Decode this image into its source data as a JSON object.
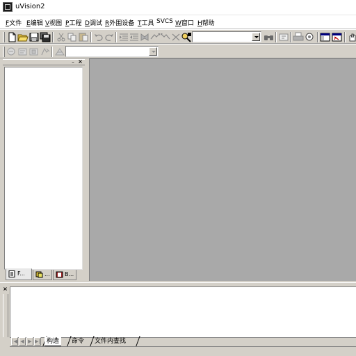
{
  "window": {
    "title": "uVision2"
  },
  "menu": {
    "items": [
      {
        "key": "F",
        "label": "文件"
      },
      {
        "key": "E",
        "label": "编辑"
      },
      {
        "key": "V",
        "label": "视图"
      },
      {
        "key": "P",
        "label": "工程"
      },
      {
        "key": "D",
        "label": "调试"
      },
      {
        "key": "R",
        "label": "外围设备"
      },
      {
        "key": "T",
        "label": "工具"
      },
      {
        "key": "",
        "label": "SVCS"
      },
      {
        "key": "W",
        "label": "窗口"
      },
      {
        "key": "H",
        "label": "帮助"
      }
    ]
  },
  "toolbar": {
    "find_combo_value": "",
    "target_combo_value": ""
  },
  "workspace": {
    "float_glyph": "–",
    "close_glyph": "×",
    "tabs": [
      {
        "label": "F..."
      },
      {
        "label": "..."
      },
      {
        "label": "B..."
      }
    ]
  },
  "output": {
    "close_glyph": "×",
    "tabs": [
      {
        "label": "构造"
      },
      {
        "label": "命令"
      },
      {
        "label": "文件内查找"
      }
    ],
    "nav": [
      "|◀",
      "◀",
      "▶",
      "▶|"
    ]
  },
  "colors": {
    "face": "#d4d0c8",
    "mdi_background": "#a9a9a9",
    "window_bg": "#ffffff"
  }
}
